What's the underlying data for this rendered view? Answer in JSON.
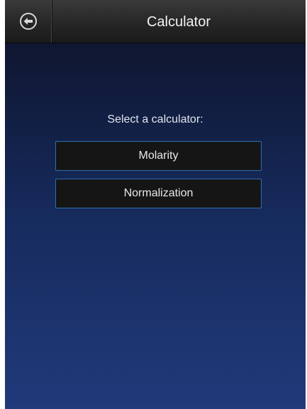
{
  "header": {
    "title": "Calculator",
    "back_icon": "back-arrow-circle-icon"
  },
  "main": {
    "prompt": "Select a calculator:",
    "buttons": [
      {
        "label": "Molarity"
      },
      {
        "label": "Normalization"
      }
    ]
  },
  "colors": {
    "button_border": "#2d6fb0",
    "button_bg": "#151515",
    "background_top": "#0f1630",
    "background_bottom": "#203a7a"
  }
}
